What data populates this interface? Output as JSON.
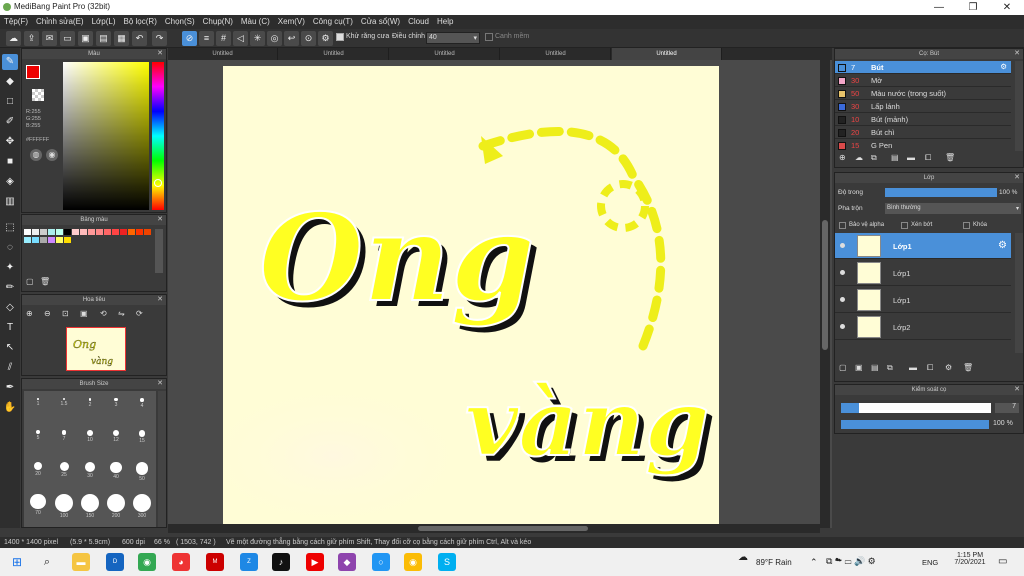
{
  "window": {
    "title": "MediBang Paint Pro (32bit)",
    "min": "—",
    "max": "❐",
    "close": "✕"
  },
  "menu": [
    "Tệp(F)",
    "Chỉnh sửa(E)",
    "Lớp(L)",
    "Bộ lọc(R)",
    "Chọn(S)",
    "Chụp(N)",
    "Màu (C)",
    "Xem(V)",
    "Công cụ(T)",
    "Cửa sổ(W)",
    "Cloud",
    "Help"
  ],
  "toolbar": {
    "antialias_label": "Khử răng cưa",
    "adjust_label": "Điều chỉnh",
    "adjust_value": "40",
    "smooth_label": "Canh mềm"
  },
  "panels": {
    "color": {
      "title": "Màu",
      "r": "R:255",
      "g": "G:255",
      "b": "B:255",
      "hex": "#FFFFFF"
    },
    "palette": {
      "title": "Bảng màu"
    },
    "navigator": {
      "title": "Hoa tiêu"
    },
    "brush_size": {
      "title": "Brush Size",
      "sizes": [
        "1",
        "1.5",
        "2",
        "3",
        "4",
        "5",
        "7",
        "10",
        "12",
        "15",
        "20",
        "25",
        "30",
        "40",
        "50",
        "70",
        "100",
        "150",
        "200",
        "300"
      ]
    },
    "brush": {
      "title": "Cọ: Bút"
    },
    "layer": {
      "title": "Lớp",
      "opacity_label": "Độ trong",
      "opacity_value": "100 %",
      "blend_label": "Pha trộn",
      "blend_value": "Bình thường",
      "protect_alpha": "Bảo vệ alpha",
      "clipping": "Xén bớt",
      "lock": "Khóa"
    },
    "control": {
      "title": "Kiểm soát cọ",
      "size_value": "7",
      "opacity_value": "100 %"
    }
  },
  "brushes": [
    {
      "size": "7",
      "name": "Bút",
      "color": "#4a90d9",
      "selected": true
    },
    {
      "size": "30",
      "name": "Mờ",
      "color": "#f4a6c8"
    },
    {
      "size": "50",
      "name": "Màu nước (trong suốt)",
      "color": "#e8c36a"
    },
    {
      "size": "30",
      "name": "Lấp lánh",
      "color": "#3a6ad9"
    },
    {
      "size": "10",
      "name": "Bút (mảnh)",
      "color": "#222222"
    },
    {
      "size": "20",
      "name": "Bút chì",
      "color": "#222222"
    },
    {
      "size": "15",
      "name": "G Pen",
      "color": "#d94a4a"
    }
  ],
  "layers": [
    {
      "name": "Lớp1",
      "selected": true
    },
    {
      "name": "Lớp1"
    },
    {
      "name": "Lớp1"
    },
    {
      "name": "Lớp2"
    }
  ],
  "tabs": [
    "Untitled",
    "Untitled",
    "Untitled",
    "Untitled",
    "Untitled"
  ],
  "artwork": {
    "line1": "Ong",
    "line2": "vàng"
  },
  "status": {
    "size": "1400 * 1400 pixel",
    "cm": "(5.9 * 5.9cm)",
    "dpi": "600 dpi",
    "zoom": "66 %",
    "coords": "( 1503, 742 )",
    "hint": "Vẽ một đường thẳng bằng cách giữ phím Shift, Thay đổi cỡ cọ bằng cách giữ phím Ctrl, Alt và kéo"
  },
  "taskbar": {
    "weather": "89°F Rain",
    "lang": "ENG",
    "time": "1:15 PM",
    "date": "7/20/2021"
  },
  "colors": {
    "accent": "#4a90d9",
    "canvas": "#fffdd6",
    "ink": "#ffff22"
  }
}
